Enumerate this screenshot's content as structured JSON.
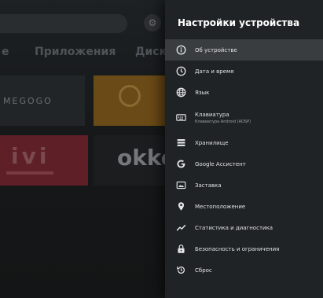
{
  "background": {
    "tabs": [
      {
        "label": "е"
      },
      {
        "label": "Приложения"
      },
      {
        "label": "Диск"
      }
    ],
    "tiles": {
      "megogo": "MEGOGO",
      "ivi": "ivi",
      "okko": "okko"
    }
  },
  "panel": {
    "title": "Настройки устройства",
    "items": [
      {
        "label": "Об устройстве",
        "icon": "info-icon"
      },
      {
        "label": "Дата и время",
        "icon": "clock-icon"
      },
      {
        "label": "Язык",
        "icon": "globe-icon"
      },
      {
        "label": "Клавиатура",
        "sublabel": "Клавиатура Android (AOSP)",
        "icon": "keyboard-icon"
      },
      {
        "label": "Хранилище",
        "icon": "storage-icon"
      },
      {
        "label": "Google Ассистент",
        "icon": "google-icon"
      },
      {
        "label": "Заставка",
        "icon": "screensaver-icon"
      },
      {
        "label": "Местоположение",
        "icon": "location-icon"
      },
      {
        "label": "Статистика и диагностика",
        "icon": "diagnostics-icon"
      },
      {
        "label": "Безопасность и ограничения",
        "icon": "lock-icon"
      },
      {
        "label": "Сброс",
        "icon": "reset-icon"
      }
    ]
  },
  "colors": {
    "panel_bg": "#202325",
    "selected_bg": "#3a3d40",
    "text": "#e1e3e4"
  }
}
